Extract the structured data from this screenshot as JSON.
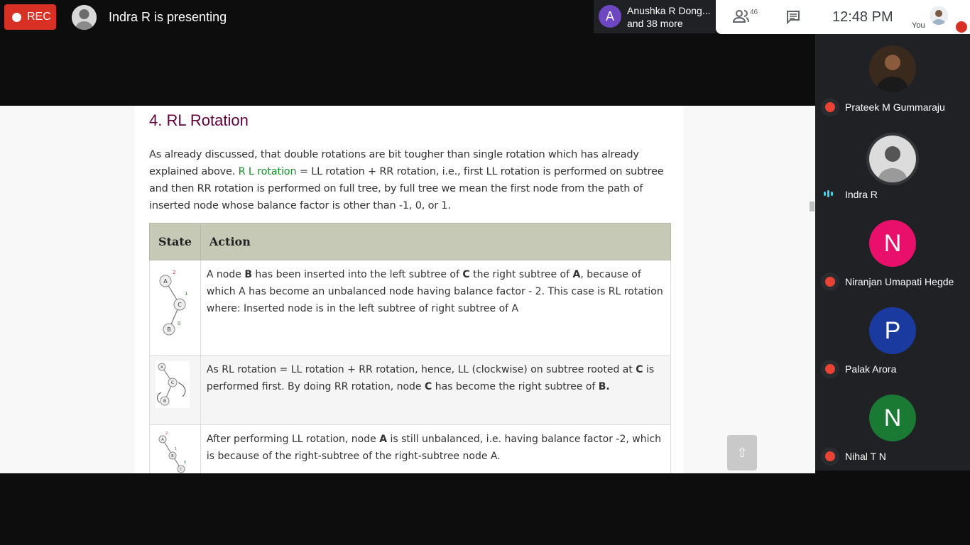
{
  "top_bar": {
    "rec_label": "REC",
    "presenting_text": "Indra R is presenting",
    "people_avatar_letter": "A",
    "people_line1": "Anushka R Dong...",
    "people_line2": "and 38 more",
    "participant_count": "46",
    "clock": "12:48 PM",
    "you_label": "You"
  },
  "page": {
    "heading": "4. RL Rotation",
    "para_1": "As already discussed, that double rotations are bit tougher than single rotation which has already explained above. ",
    "para_link": "R L rotation",
    "para_2": " = LL rotation + RR rotation, i.e., first LL rotation is performed on subtree and then RR rotation is performed on full tree, by full tree we mean the first node from the path of inserted node whose balance factor is other than -1, 0, or 1.",
    "table": {
      "headers": [
        "State",
        "Action"
      ],
      "rows": [
        {
          "t1": "A node ",
          "b1": "B",
          "t2": " has been inserted into the left subtree of ",
          "b2": "C",
          "t3": " the right subtree of ",
          "b3": "A",
          "t4": ", because of which A has become an unbalanced node having balance factor - 2. This case is RL rotation where: Inserted node is in the left subtree of right subtree of A"
        },
        {
          "t1": "As RL rotation = LL rotation + RR rotation, hence, LL (clockwise) on subtree rooted at ",
          "b1": "C",
          "t2": " is performed first. By doing RR rotation, node ",
          "b2": "C",
          "t3": " has become the right subtree of ",
          "b3": "B.",
          "t4": ""
        },
        {
          "t1": "After performing LL rotation, node ",
          "b1": "A",
          "t2": " is still unbalanced, i.e. having balance factor -2, which is because of the right-subtree of the right-subtree node A.",
          "b2": "",
          "t3": "",
          "b3": "",
          "t4": ""
        }
      ]
    },
    "diagram1": {
      "a": "A",
      "c": "C",
      "b": "B",
      "bf_a": "2",
      "bf_c": "1",
      "bf_b": "0"
    },
    "diagram2": {
      "a": "A",
      "c": "C",
      "b": "B"
    },
    "diagram3": {
      "a": "A",
      "b": "B",
      "c": "C",
      "bf_a": "2",
      "bf_b": "1",
      "bf_c": "0"
    },
    "scroll_top_glyph": "⇧"
  },
  "participants": [
    {
      "name": "Prateek M Gummaraju",
      "letter": "",
      "color": "#3a2a1e",
      "muted": true
    },
    {
      "name": "Indra R",
      "letter": "",
      "color": "#dcdcdc",
      "muted": false
    },
    {
      "name": "Niranjan Umapati Hegde",
      "letter": "N",
      "color": "#e8106a",
      "muted": true
    },
    {
      "name": "Palak Arora",
      "letter": "P",
      "color": "#1a3aa0",
      "muted": true
    },
    {
      "name": "Nihal T N",
      "letter": "N",
      "color": "#1a7a33",
      "muted": true
    }
  ],
  "colors": {
    "rec": "#d93025",
    "heading": "#61003b",
    "link_green": "#1b8e2d",
    "table_header": "#c7c9b7"
  }
}
